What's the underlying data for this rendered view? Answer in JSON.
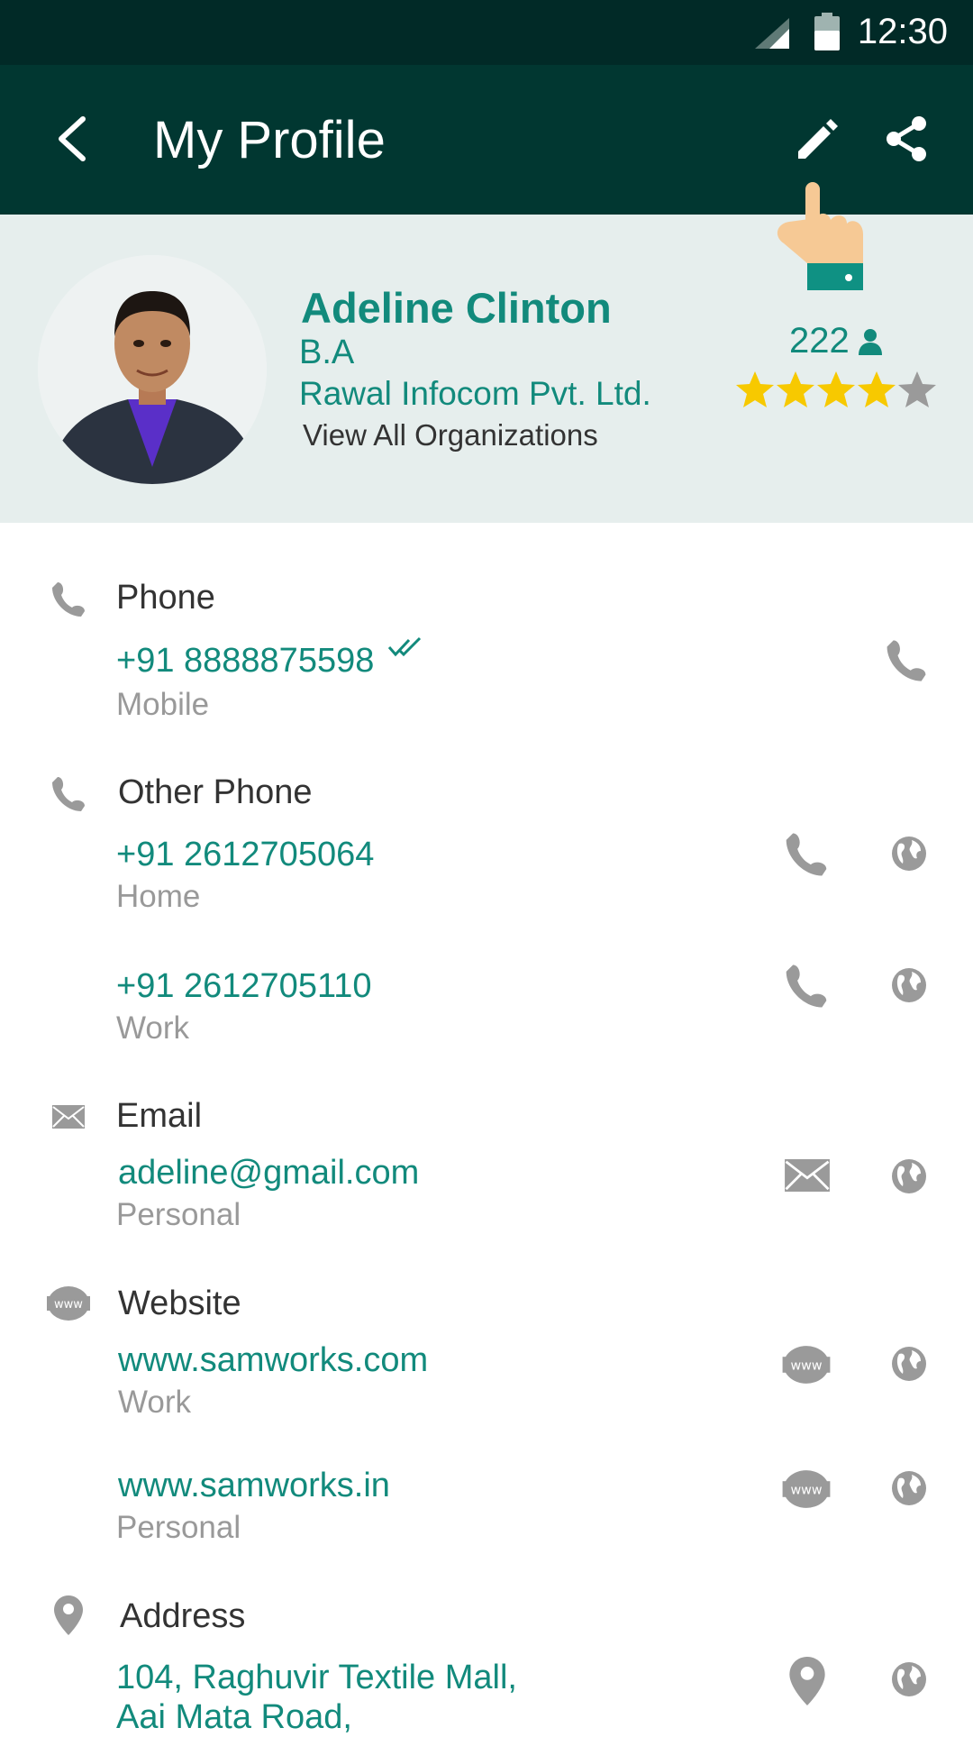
{
  "status_bar": {
    "time": "12:30"
  },
  "app_bar": {
    "title": "My Profile"
  },
  "profile": {
    "name": "Adeline Clinton",
    "degree": "B.A",
    "organization": "Rawal Infocom Pvt. Ltd.",
    "view_all": "View All Organizations",
    "followers": "222",
    "rating": 4,
    "rating_max": 5
  },
  "phone": {
    "label": "Phone",
    "number": "+91 8888875598",
    "type": "Mobile"
  },
  "other_phone": {
    "label": "Other Phone",
    "entries": [
      {
        "number": "+91 2612705064",
        "type": "Home"
      },
      {
        "number": "+91 2612705110",
        "type": "Work"
      }
    ]
  },
  "email": {
    "label": "Email",
    "value": "adeline@gmail.com",
    "type": "Personal"
  },
  "website": {
    "label": "Website",
    "icon_text": "www",
    "entries": [
      {
        "url": "www.samworks.com",
        "type": "Work"
      },
      {
        "url": "www.samworks.in",
        "type": "Personal"
      }
    ]
  },
  "address": {
    "label": "Address",
    "line1": "104, Raghuvir Textile Mall,",
    "line2": "Aai Mata Road,"
  },
  "colors": {
    "appbar": "#013731",
    "statusbar": "#012a27",
    "accent": "#128a7c",
    "header_bg": "#e6eeed",
    "star": "#f7c900",
    "icon_gray": "#9a9a9a"
  }
}
